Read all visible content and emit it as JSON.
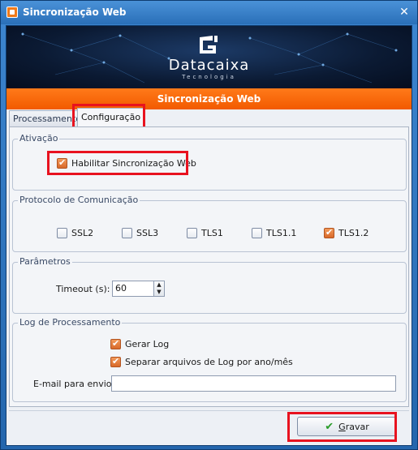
{
  "window": {
    "title": "Sincronização Web",
    "close_glyph": "✕"
  },
  "banner": {
    "brand": "Datacaixa",
    "tagline": "Tecnologia",
    "section_title": "Sincronização Web"
  },
  "tabs": [
    {
      "label": "Processamento",
      "active": false
    },
    {
      "label": "Configuração",
      "active": true
    }
  ],
  "ativacao": {
    "title": "Ativação",
    "habilitar": {
      "label": "Habilitar Sincronização Web",
      "checked": true
    }
  },
  "protocolo": {
    "title": "Protocolo de Comunicação",
    "options": [
      {
        "label": "SSL2",
        "checked": false
      },
      {
        "label": "SSL3",
        "checked": false
      },
      {
        "label": "TLS1",
        "checked": false
      },
      {
        "label": "TLS1.1",
        "checked": false
      },
      {
        "label": "TLS1.2",
        "checked": true
      }
    ]
  },
  "parametros": {
    "title": "Parâmetros",
    "timeout_label": "Timeout (s):",
    "timeout_value": "60"
  },
  "log": {
    "title": "Log de Processamento",
    "gerar": {
      "label": "Gerar Log",
      "checked": true
    },
    "separar": {
      "label": "Separar arquivos de Log por ano/mês",
      "checked": true
    },
    "email_label": "E-mail para envio:",
    "email_value": ""
  },
  "footer": {
    "save_label_prefix": "",
    "save_label_mnemonic": "G",
    "save_label_rest": "ravar"
  },
  "colors": {
    "accent_orange": "#f25a00",
    "highlight_red": "#e8121f",
    "title_blue": "#2a6fb8"
  }
}
